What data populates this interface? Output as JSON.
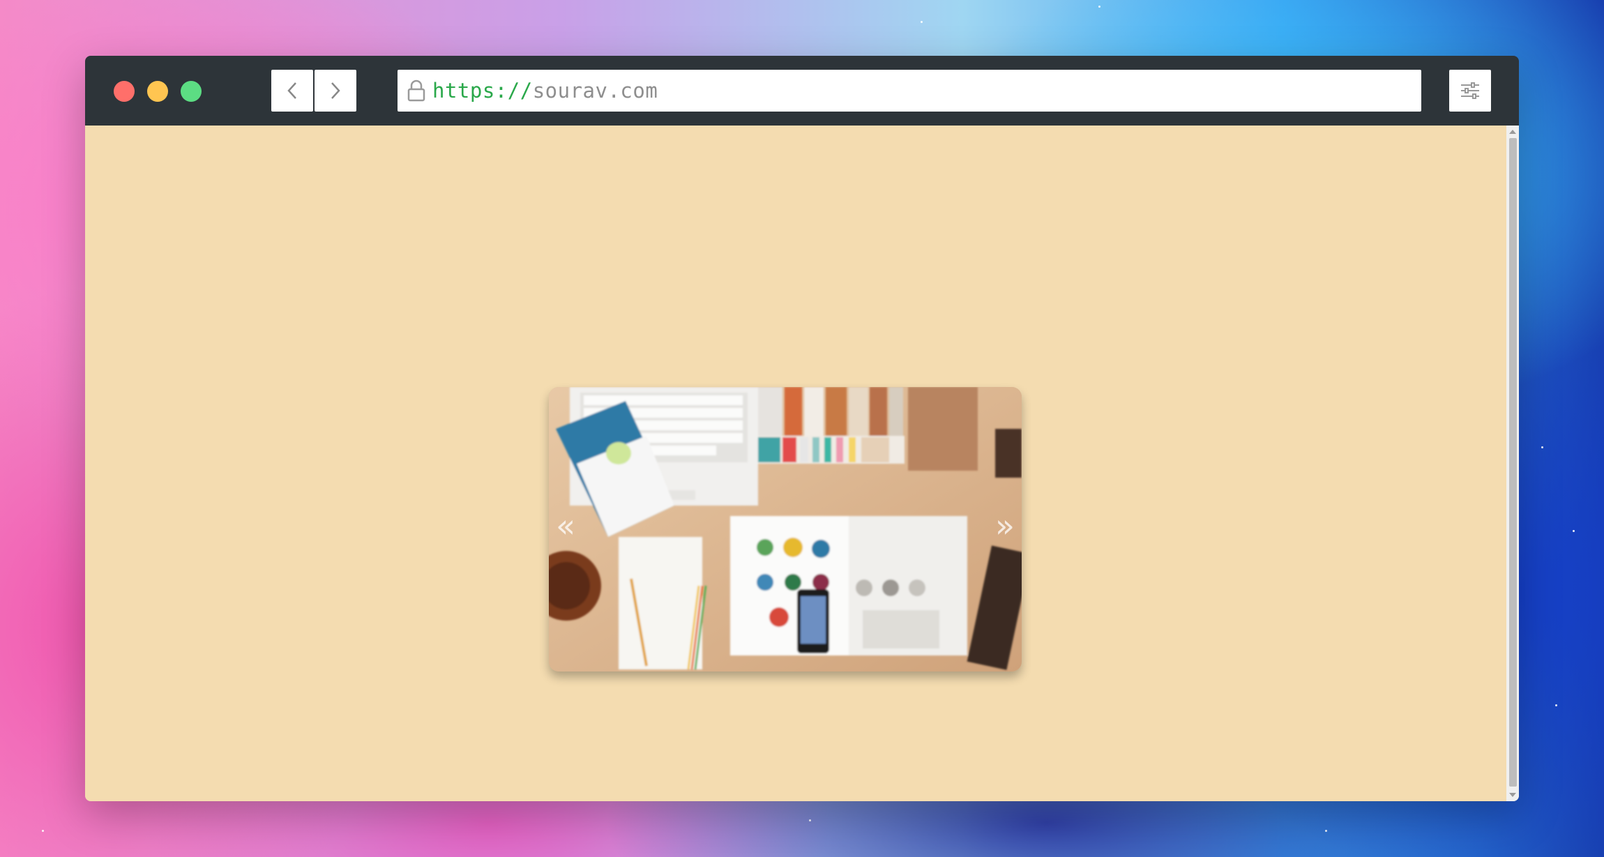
{
  "browser": {
    "url_scheme": "https://",
    "url_host": "sourav.com",
    "icons": {
      "back": "chevron-left-icon",
      "forward": "chevron-right-icon",
      "lock": "lock-icon",
      "settings": "sliders-icon"
    },
    "traffic_lights": {
      "close": "#ff6f6a",
      "minimize": "#ffc551",
      "maximize": "#5cdd83"
    },
    "titlebar_color": "#2d3439"
  },
  "page": {
    "background_color": "#f4dcb0",
    "slider": {
      "prev_label": "«",
      "next_label": "»",
      "image_subject": "desk-flatlay-photo"
    }
  }
}
